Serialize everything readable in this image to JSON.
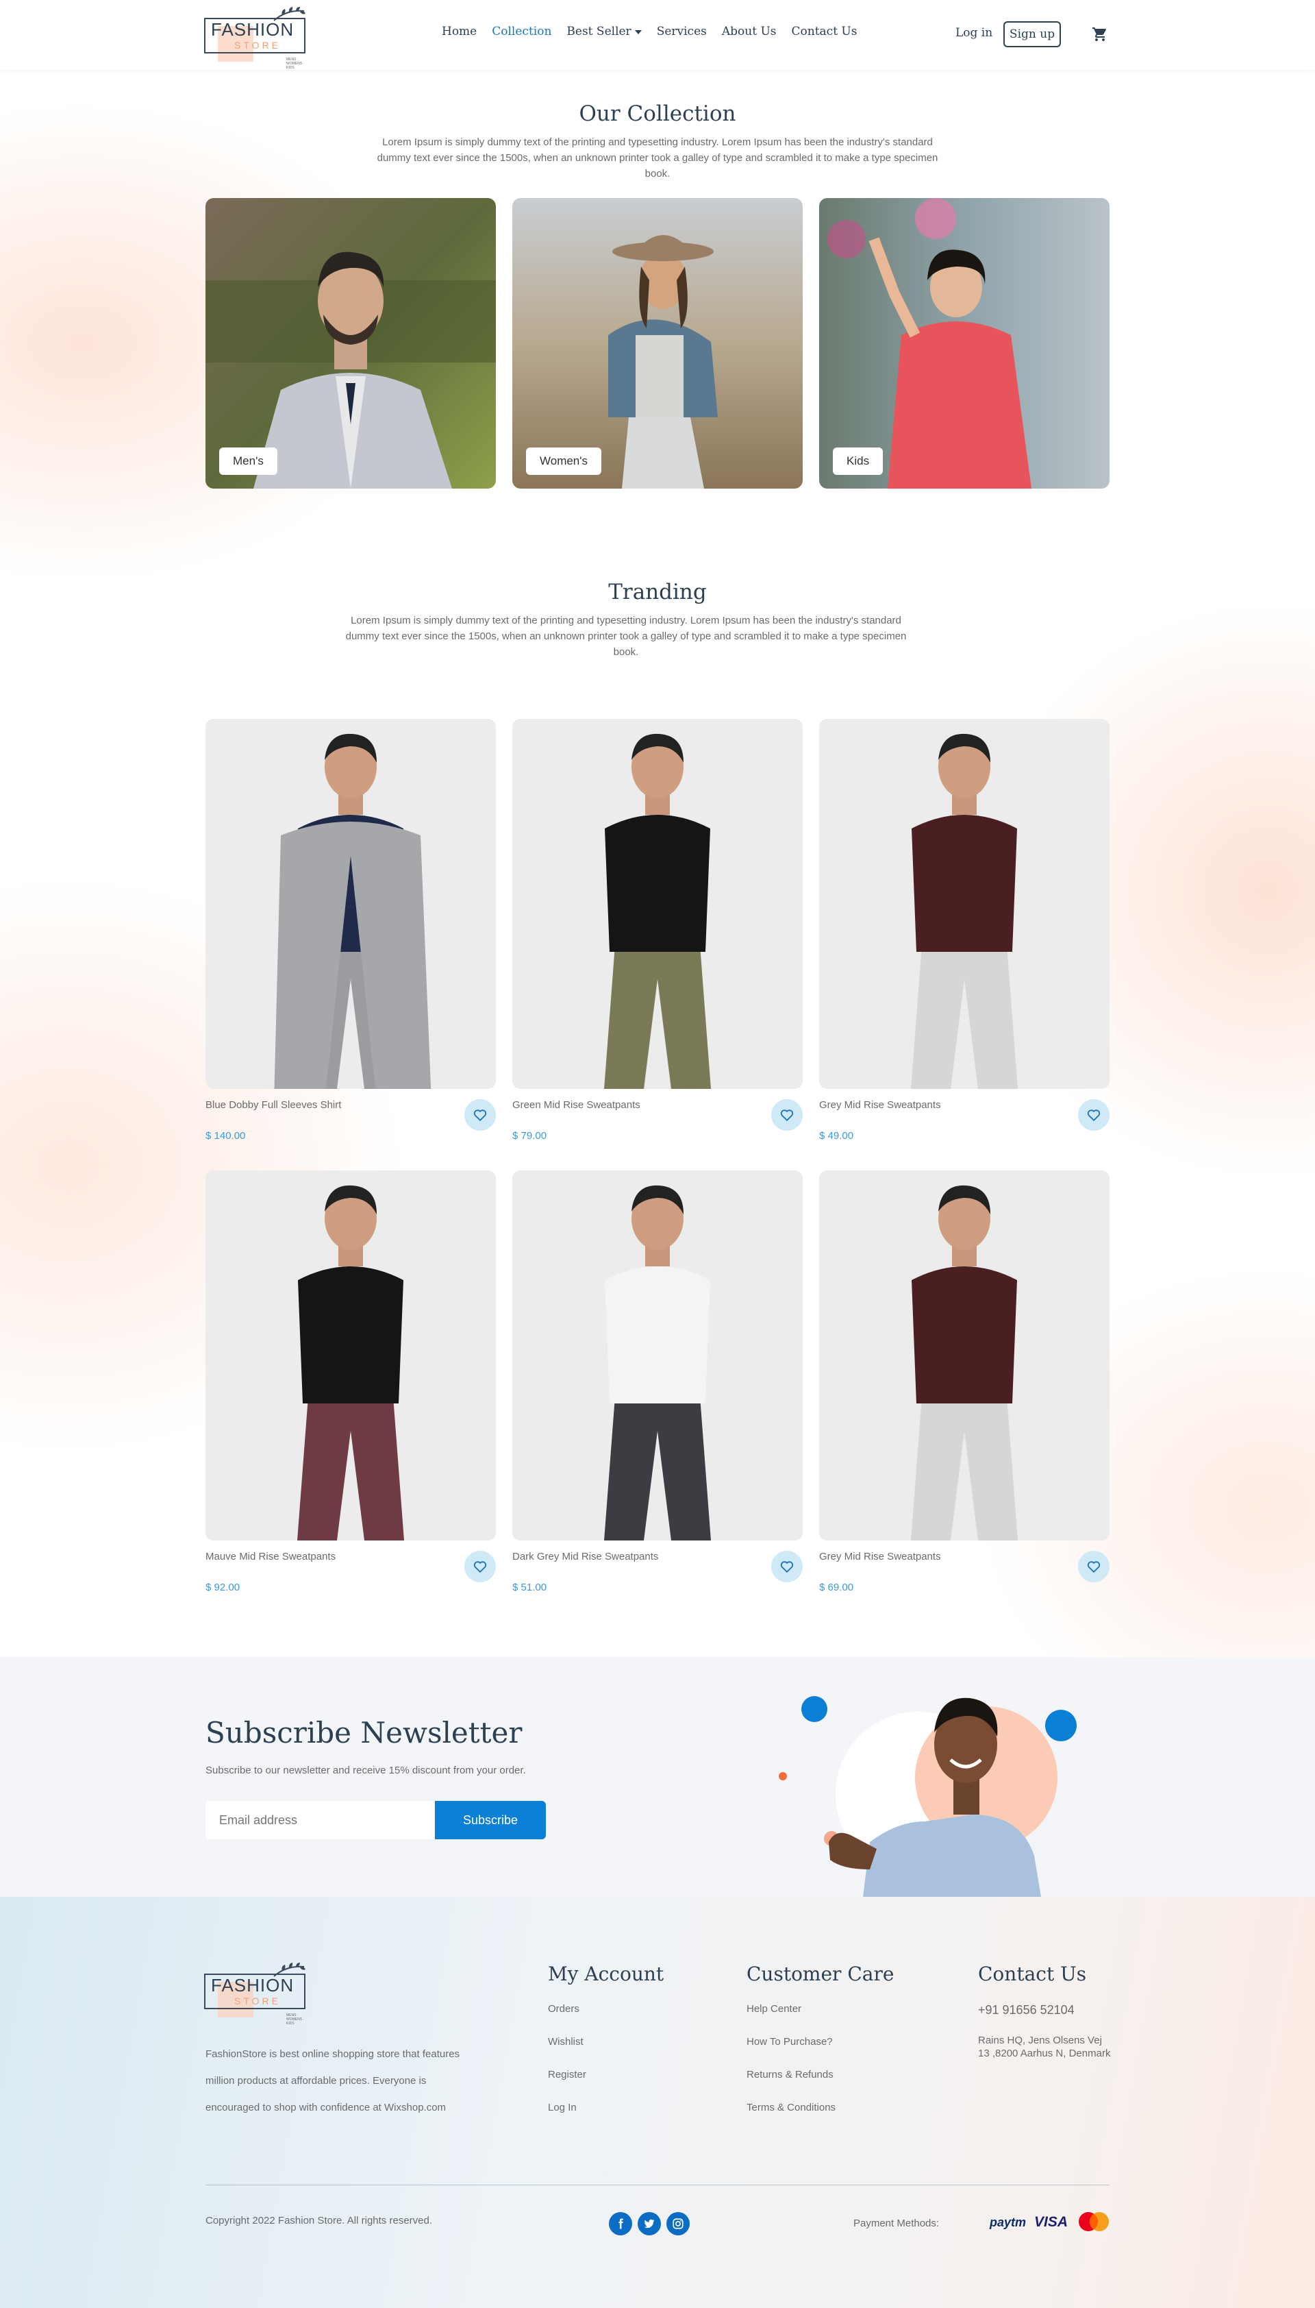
{
  "header": {
    "logo": {
      "brand": "FASHION",
      "sub": "STORE",
      "tag": "MENS · WOMENS · KIDS"
    },
    "nav": [
      {
        "label": "Home"
      },
      {
        "label": "Collection"
      },
      {
        "label": "Best Seller"
      },
      {
        "label": "Services"
      },
      {
        "label": "About Us"
      },
      {
        "label": "Contact Us"
      }
    ],
    "login": "Log in",
    "signup": "Sign up"
  },
  "collection": {
    "title": "Our Collection",
    "text": "Lorem Ipsum is simply dummy text of the printing and typesetting industry. Lorem Ipsum has been the industry's standard dummy text ever since the 1500s, when an unknown printer took a galley of type and scrambled it to make a type specimen book.",
    "cards": [
      {
        "label": "Men's"
      },
      {
        "label": "Women's"
      },
      {
        "label": "Kids"
      }
    ]
  },
  "trending": {
    "title": "Tranding",
    "text": "Lorem Ipsum is simply dummy text of the printing and typesetting industry. Lorem Ipsum has been the industry's standard dummy text ever since the 1500s, when an unknown printer took a galley of type and scrambled it to make a type specimen book.",
    "products": [
      {
        "name": "Blue Dobby Full Sleeves Shirt",
        "price": "$ 140.00"
      },
      {
        "name": "Green Mid Rise Sweatpants",
        "price": "$ 79.00"
      },
      {
        "name": "Grey Mid Rise Sweatpants",
        "price": "$ 49.00"
      },
      {
        "name": "Mauve Mid Rise Sweatpants",
        "price": "$ 92.00"
      },
      {
        "name": "Dark Grey Mid Rise Sweatpants",
        "price": "$ 51.00"
      },
      {
        "name": "Grey Mid Rise Sweatpants",
        "price": "$ 69.00"
      }
    ]
  },
  "newsletter": {
    "title": "Subscribe Newsletter",
    "text": "Subscribe to our newsletter and receive 15% discount from your order.",
    "placeholder": "Email address",
    "button": "Subscribe"
  },
  "footer": {
    "desc": "FashionStore is best online shopping store that features million products at affordable prices. Everyone is encouraged to shop with confidence at Wixshop.com",
    "account": {
      "title": "My Account",
      "links": [
        "Orders",
        "Wishlist",
        "Register",
        "Log In"
      ]
    },
    "care": {
      "title": "Customer Care",
      "links": [
        "Help Center",
        "How To Purchase?",
        "Returns & Refunds",
        "Terms & Conditions"
      ]
    },
    "contact": {
      "title": "Contact Us",
      "phone": "+91 91656 52104",
      "address": "Rains HQ, Jens Olsens Vej 13 ,8200 Aarhus N, Denmark"
    },
    "copyright": "Copyright 2022 Fashion Store. All rights reserved.",
    "payment_label": "Payment Methods:",
    "payments": {
      "paytm": "paytm",
      "visa": "VISA"
    },
    "icons": [
      "facebook-icon",
      "twitter-icon",
      "instagram-icon",
      "cart-icon",
      "heart-icon"
    ]
  },
  "colors": {
    "accent": "#0a7fd6",
    "navy": "#2d3f52",
    "peach": "#fbd3c0",
    "price": "#3a9ad9"
  }
}
